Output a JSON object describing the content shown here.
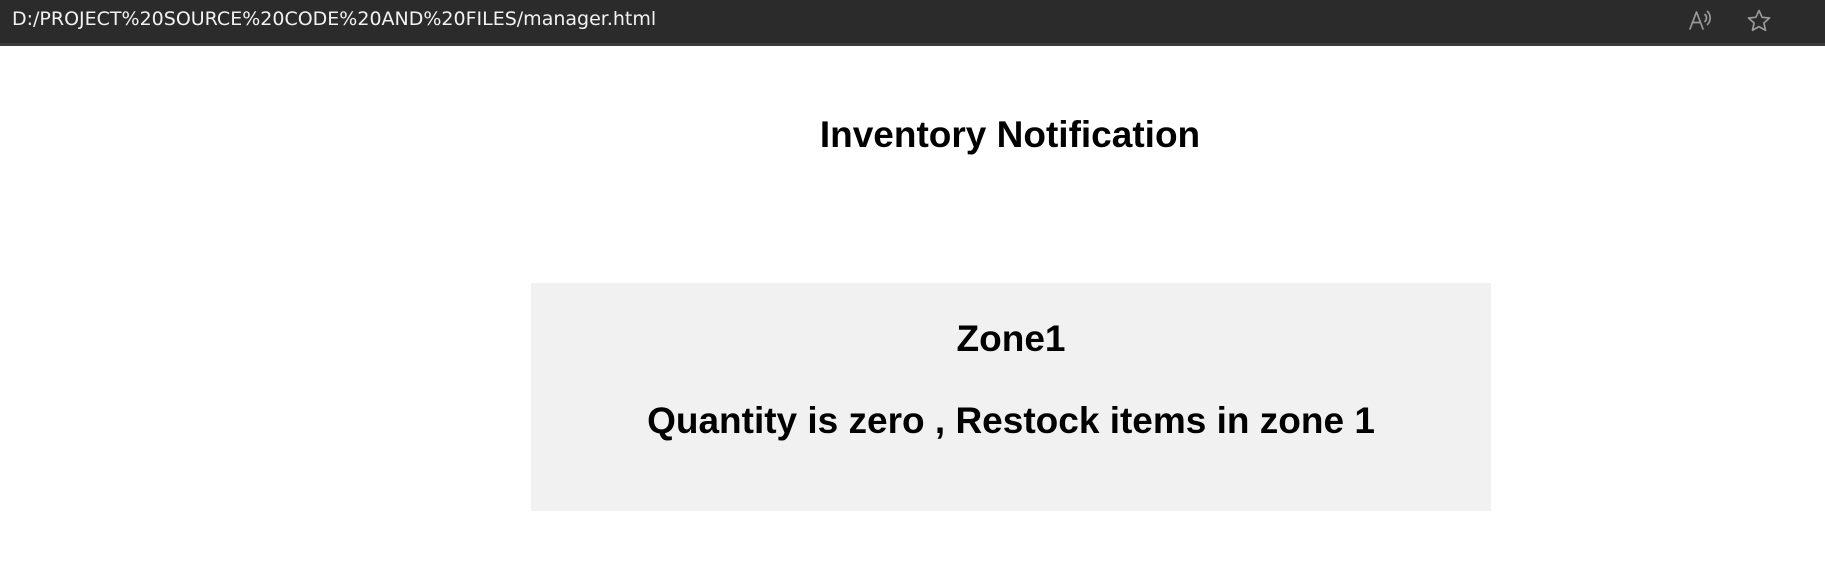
{
  "browser": {
    "address": "D:/PROJECT%20SOURCE%20CODE%20AND%20FILES/manager.html",
    "icons": [
      "read-aloud-icon",
      "favorite-star-icon"
    ]
  },
  "page": {
    "title": "Inventory Notification",
    "notification": {
      "zone": "Zone1",
      "message": "Quantity is zero , Restock items in zone 1"
    }
  },
  "colors": {
    "browser_bar": "#2b2b2b",
    "page_background": "#ffffff",
    "card_background": "#f1f1f1",
    "text": "#000000"
  }
}
